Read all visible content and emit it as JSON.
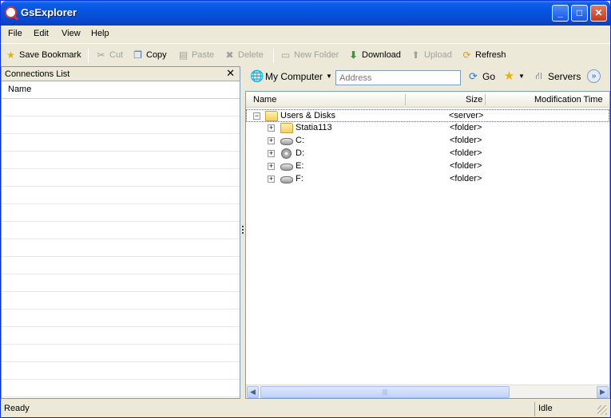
{
  "window": {
    "title": "GsExplorer"
  },
  "menu": [
    "File",
    "Edit",
    "View",
    "Help"
  ],
  "toolbar": {
    "save_bookmark": "Save Bookmark",
    "cut": "Cut",
    "copy": "Copy",
    "paste": "Paste",
    "delete": "Delete",
    "new_folder": "New Folder",
    "download": "Download",
    "upload": "Upload",
    "refresh": "Refresh"
  },
  "connections": {
    "title": "Connections List",
    "close_glyph": "✕",
    "column_name": "Name"
  },
  "address_bar": {
    "location": "My Computer",
    "placeholder": "Address",
    "go": "Go",
    "servers": "Servers"
  },
  "file_list": {
    "columns": {
      "name": "Name",
      "size": "Size",
      "modified": "Modification Time"
    },
    "rows": [
      {
        "name": "Users & Disks",
        "size": "<server>",
        "icon": "folder-icon",
        "expander": "−"
      },
      {
        "name": "Statia113",
        "size": "<folder>",
        "icon": "folder-icon",
        "expander": "+"
      },
      {
        "name": "C:",
        "size": "<folder>",
        "icon": "hard-drive-icon",
        "expander": "+"
      },
      {
        "name": "D:",
        "size": "<folder>",
        "icon": "cd-drive-icon",
        "expander": "+"
      },
      {
        "name": "E:",
        "size": "<folder>",
        "icon": "hard-drive-icon",
        "expander": "+"
      },
      {
        "name": "F:",
        "size": "<folder>",
        "icon": "hard-drive-icon",
        "expander": "+"
      }
    ]
  },
  "status": {
    "text": "Ready",
    "state": "Idle"
  }
}
